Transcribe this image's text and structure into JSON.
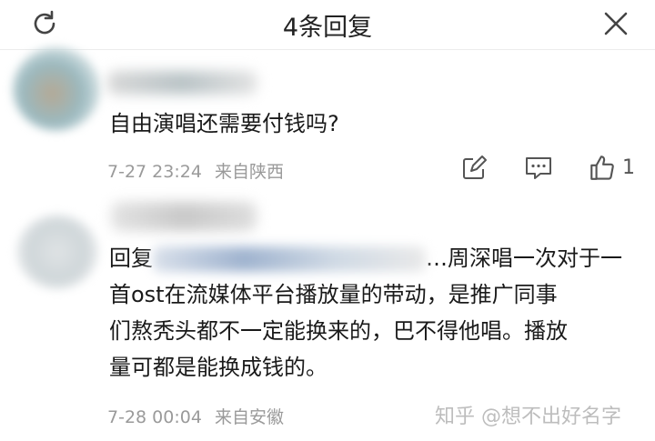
{
  "header": {
    "title": "4条回复",
    "refresh_icon": "refresh-icon",
    "close_icon": "close-icon"
  },
  "comments": [
    {
      "text": "自由演唱还需要付钱吗?",
      "time": "7-27 23:24",
      "location": "来自陕西",
      "likes": "1",
      "icons": [
        "reply-edit-icon",
        "comment-icon",
        "like-icon"
      ]
    },
    {
      "text_lines": [
        "回复",
        "…周深唱一次对于一",
        "首ost在流媒体平台播放量的带动，是推广同事",
        "们熬秃头都不一定能换来的，巴不得他唱。播放",
        "量可都是能换成钱的。"
      ],
      "time": "7-28 00:04",
      "location": "来自安徽"
    }
  ],
  "watermark": "知乎 @想不出好名字"
}
